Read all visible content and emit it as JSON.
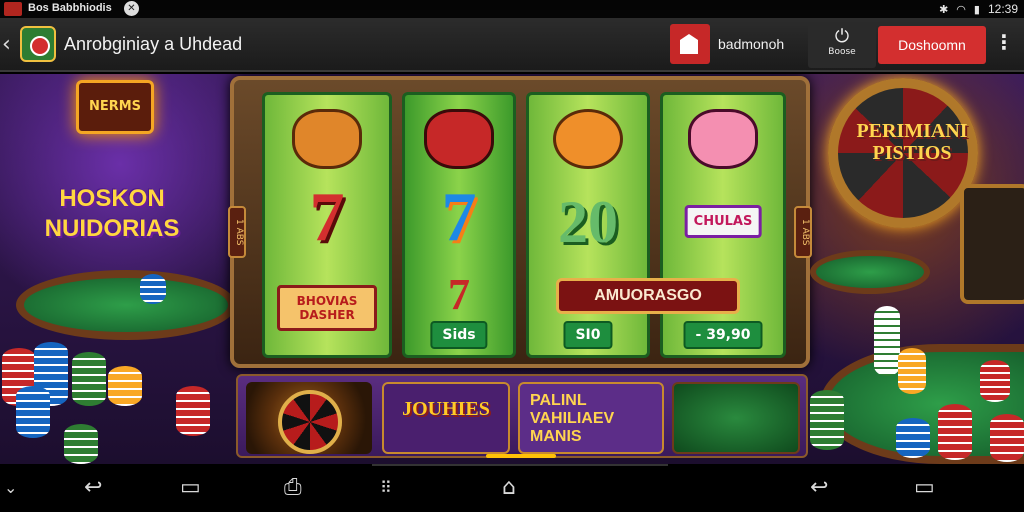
{
  "status_bar": {
    "notification_text": "Bos Babbhiodis",
    "time": "12:39"
  },
  "app_bar": {
    "title": "Anrobginiay a Uhdead",
    "action_label": "badmonoh",
    "power_label": "Boose",
    "primary_button_label": "Doshoomn"
  },
  "game": {
    "neon_sign": "NERMS",
    "left_logo": "HOSKON NUIDORIAS",
    "payline_left": "1 ABS",
    "payline_right": "1 ABS",
    "reels": [
      {
        "mid_symbol": "7",
        "bottom_label": "BHOVIAS DASHER",
        "value": ""
      },
      {
        "mid_symbol": "7",
        "bottom_label": "",
        "value": "Sids"
      },
      {
        "mid_symbol": "20",
        "bottom_label": "",
        "value": "SI0"
      },
      {
        "mid_symbol": "",
        "bottom_label": "CHULAS",
        "value": "- 39,90"
      }
    ],
    "banner": "AMUORASGO",
    "right_sign": "PERIMIANI PISTIOS",
    "promos": {
      "jackpot": "JOUHIES",
      "text": "PALINL VAHILIAEV MANIS"
    }
  },
  "icons": {
    "back": "chevron-left-icon",
    "power": "power-icon",
    "menu": "kebab-menu-icon",
    "nav": [
      "collapse-icon",
      "back-icon",
      "recents-icon",
      "screenshot-icon",
      "apps-grid-icon",
      "home-icon",
      "undo-icon",
      "window-icon"
    ]
  }
}
